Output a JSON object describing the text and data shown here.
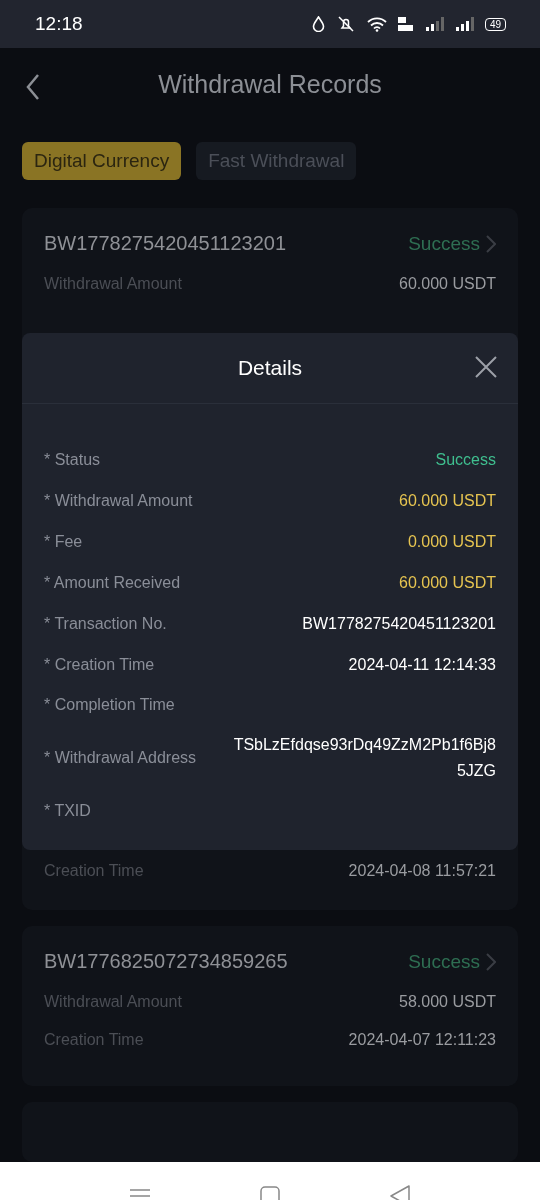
{
  "status_bar": {
    "time": "12:18",
    "battery": "49"
  },
  "header": {
    "title": "Withdrawal Records"
  },
  "tabs": [
    {
      "label": "Digital Currency",
      "selected": true
    },
    {
      "label": "Fast Withdrawal",
      "selected": false
    }
  ],
  "records": [
    {
      "kind": "full",
      "transaction_no": "BW1778275420451123201",
      "status": "Success",
      "fields": [
        {
          "label": "Withdrawal Amount",
          "value": "60.000 USDT"
        }
      ]
    },
    {
      "kind": "covered",
      "fields": [
        {
          "label": "Creation Time",
          "value": "2024-04-08 11:57:21"
        }
      ]
    },
    {
      "kind": "full",
      "transaction_no": "BW1776825072734859265",
      "status": "Success",
      "fields": [
        {
          "label": "Withdrawal Amount",
          "value": "58.000 USDT"
        },
        {
          "label": "Creation Time",
          "value": "2024-04-07 12:11:23"
        }
      ]
    },
    {
      "kind": "cut"
    }
  ],
  "details": {
    "title": "Details",
    "rows": [
      {
        "label": "* Status",
        "value": "Success",
        "color": "#3fbf8f"
      },
      {
        "label": "* Withdrawal Amount",
        "value": "60.000 USDT",
        "color": "#e6c450"
      },
      {
        "label": "* Fee",
        "value": "0.000 USDT",
        "color": "#e6c450"
      },
      {
        "label": "* Amount Received",
        "value": "60.000 USDT",
        "color": "#e6c450"
      },
      {
        "label": "* Transaction No.",
        "value": "BW1778275420451123201",
        "color": "#ffffff"
      },
      {
        "label": "* Creation Time",
        "value": "2024-04-11 12:14:33",
        "color": "#ffffff"
      },
      {
        "label": "* Completion Time"
      },
      {
        "label": "* Withdrawal Address",
        "value": "TSbLzEfdqse93rDq49ZzM2Pb1f6Bj85JZG",
        "color": "#ffffff"
      },
      {
        "label": "* TXID"
      }
    ]
  }
}
